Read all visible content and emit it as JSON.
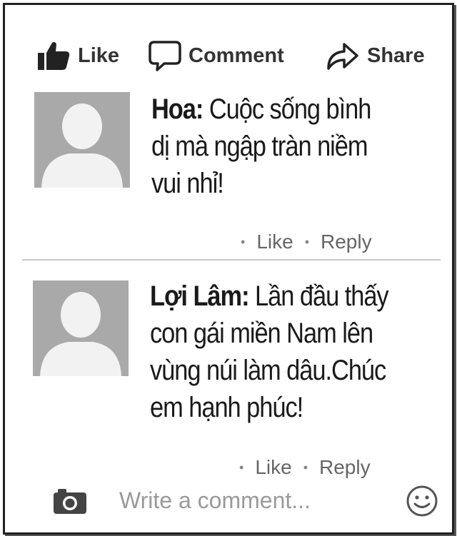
{
  "actions": {
    "like_label": "Like",
    "comment_label": "Comment",
    "share_label": "Share"
  },
  "comments": [
    {
      "author": "Hoa:",
      "lines": [
        "Cuộc sống bình",
        "dị mà ngập tràn niềm",
        "vui nhỉ!"
      ],
      "like_label": "Like",
      "reply_label": "Reply"
    },
    {
      "author": "Lợi Lâm:",
      "lines": [
        "Lần đầu thấy",
        "con gái miền Nam lên",
        "vùng núi làm dâu.Chúc",
        "em hạnh phúc!"
      ],
      "like_label": "Like",
      "reply_label": "Reply"
    }
  ],
  "composer": {
    "placeholder": "Write a comment...",
    "value": ""
  },
  "icons": {
    "like": "thumbs-up-icon",
    "comment": "speech-bubble-icon",
    "share": "share-arrow-icon",
    "camera": "camera-icon",
    "emoji": "smiley-icon",
    "avatar": "default-avatar-icon"
  },
  "colors": {
    "text": "#1a1a1a",
    "muted": "#666666",
    "avatar_bg": "#a9a9a9",
    "border": "#222222"
  }
}
